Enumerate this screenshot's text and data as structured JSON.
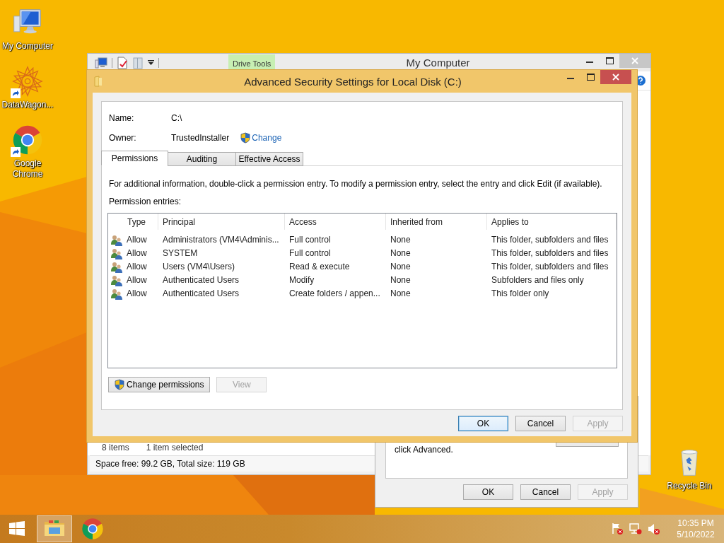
{
  "desktop_icons": [
    {
      "label": "My Computer",
      "kind": "computer",
      "shortcut": false
    },
    {
      "label": "DataWagon...",
      "kind": "datawagon",
      "shortcut": true
    },
    {
      "label": "Google Chrome",
      "kind": "chrome",
      "shortcut": true
    },
    {
      "label": "Recycle Bin",
      "kind": "recycle",
      "shortcut": false
    }
  ],
  "explorer_window": {
    "title": "My Computer",
    "ribbon_tab": "Drive Tools",
    "status_items": "8 items",
    "status_selected": "1 item selected",
    "status_space": "Space free: 99.2 GB, Total size: 119 GB"
  },
  "properties_dialog": {
    "text": "click Advanced.",
    "buttons": [
      {
        "label": "OK",
        "default": false,
        "disabled": false
      },
      {
        "label": "Cancel",
        "default": false,
        "disabled": false
      },
      {
        "label": "Apply",
        "default": false,
        "disabled": true
      }
    ]
  },
  "security_dialog": {
    "title": "Advanced Security Settings for Local Disk (C:)",
    "name_label": "Name:",
    "name_value": "C:\\",
    "owner_label": "Owner:",
    "owner_value": "TrustedInstaller",
    "owner_link": "Change",
    "tabs": [
      {
        "label": "Permissions",
        "selected": true
      },
      {
        "label": "Auditing",
        "selected": false
      },
      {
        "label": "Effective Access",
        "selected": false
      }
    ],
    "info": "For additional information, double-click a permission entry. To modify a permission entry, select the entry and click Edit (if available).",
    "entries_label": "Permission entries:",
    "columns": [
      "Type",
      "Principal",
      "Access",
      "Inherited from",
      "Applies to"
    ],
    "rows": [
      [
        "Allow",
        "Administrators (VM4\\Adminis...",
        "Full control",
        "None",
        "This folder, subfolders and files"
      ],
      [
        "Allow",
        "SYSTEM",
        "Full control",
        "None",
        "This folder, subfolders and files"
      ],
      [
        "Allow",
        "Users (VM4\\Users)",
        "Read & execute",
        "None",
        "This folder, subfolders and files"
      ],
      [
        "Allow",
        "Authenticated Users",
        "Modify",
        "None",
        "Subfolders and files only"
      ],
      [
        "Allow",
        "Authenticated Users",
        "Create folders / appen...",
        "None",
        "This folder only"
      ]
    ],
    "actions": [
      {
        "label": "Change permissions",
        "shield": true,
        "disabled": false
      },
      {
        "label": "View",
        "shield": false,
        "disabled": true
      }
    ],
    "buttons": [
      {
        "label": "OK",
        "default": true,
        "disabled": false
      },
      {
        "label": "Cancel",
        "default": false,
        "disabled": false
      },
      {
        "label": "Apply",
        "default": false,
        "disabled": true
      }
    ]
  },
  "taskbar": {
    "apps": [
      {
        "kind": "explorer",
        "active": true
      },
      {
        "kind": "chrome",
        "active": false
      }
    ],
    "tray": [
      {
        "kind": "flag"
      },
      {
        "kind": "network"
      },
      {
        "kind": "volume"
      }
    ],
    "time": "10:35 PM",
    "date": "5/10/2022"
  }
}
